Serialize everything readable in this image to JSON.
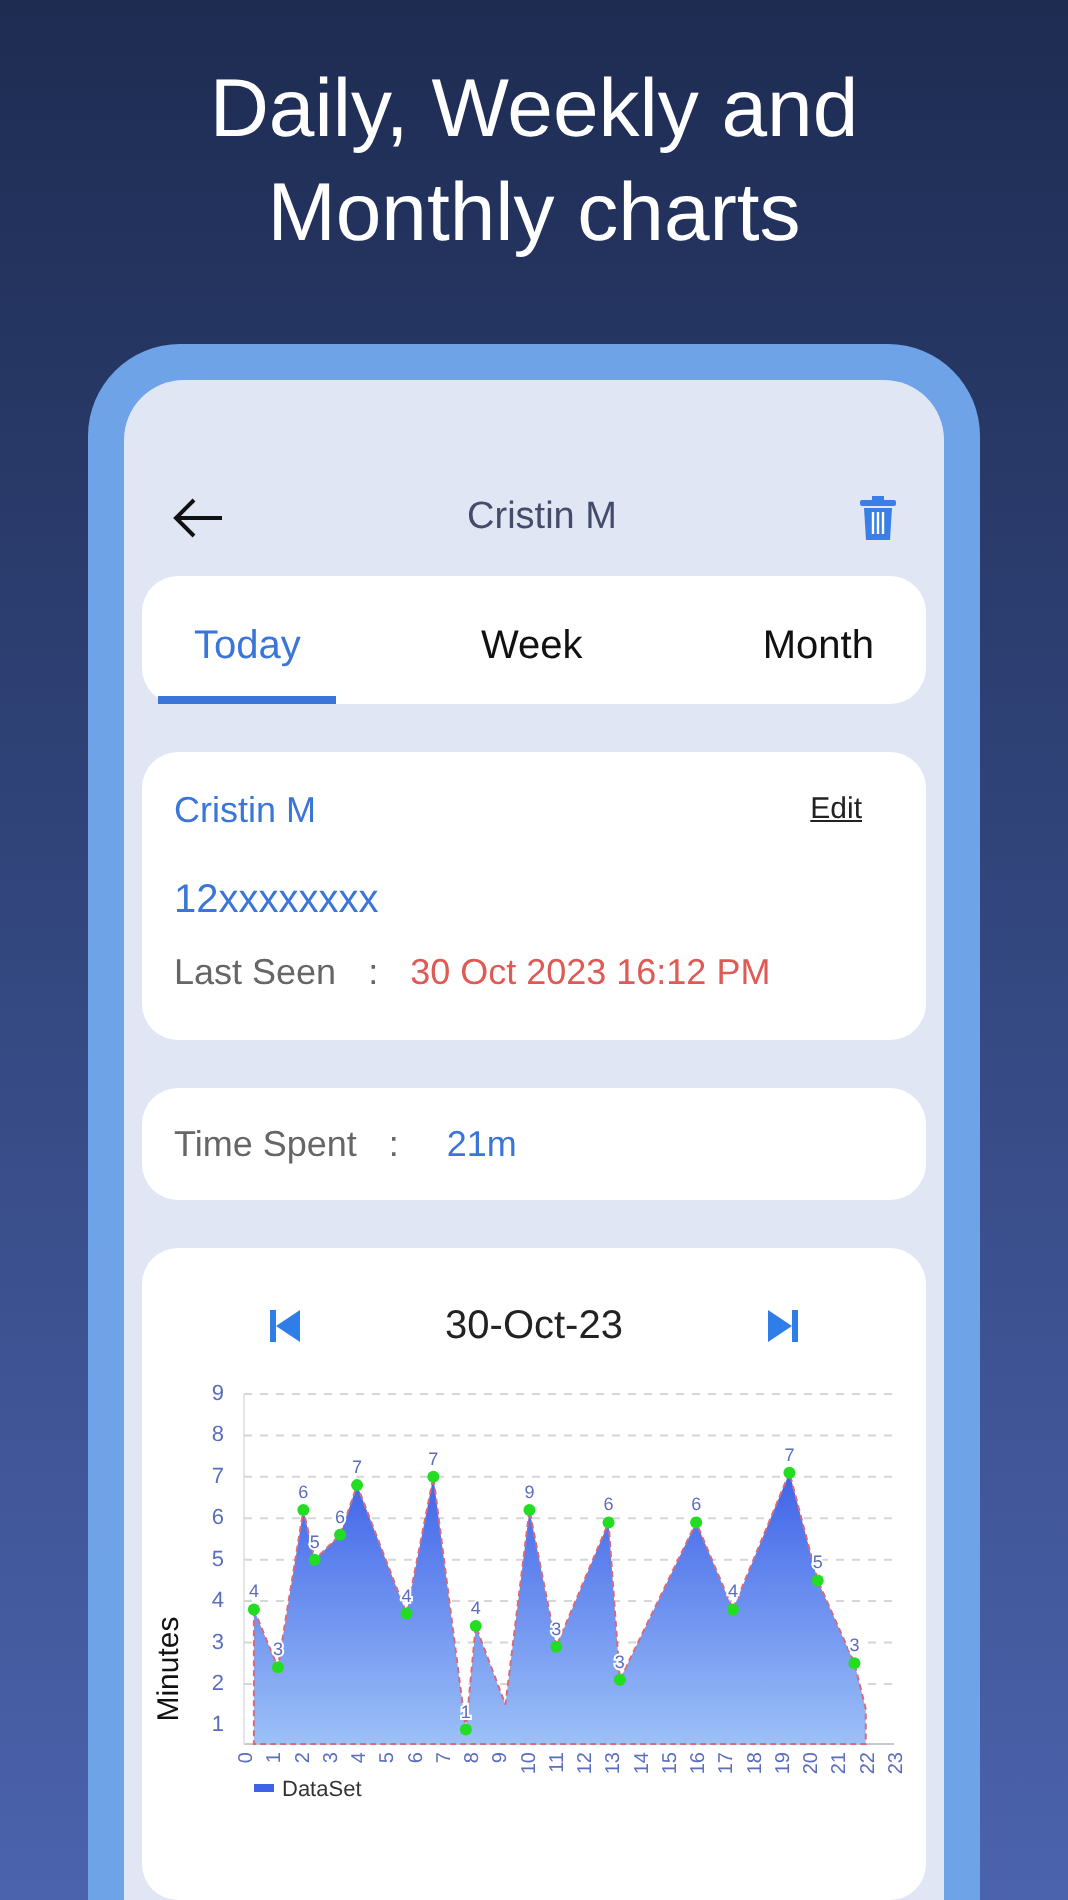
{
  "headline": "Daily, Weekly and Monthly charts",
  "header": {
    "title": "Cristin M"
  },
  "tabs": [
    {
      "label": "Today",
      "selected": true
    },
    {
      "label": "Week",
      "selected": false
    },
    {
      "label": "Month",
      "selected": false
    }
  ],
  "contact": {
    "name": "Cristin M",
    "edit": "Edit",
    "number": "12xxxxxxxx",
    "last_seen_label": "Last Seen",
    "separator": ":",
    "last_seen": "30 Oct 2023 16:12 PM"
  },
  "time_spent": {
    "label": "Time Spent",
    "separator": ":",
    "value": "21m"
  },
  "chart_card": {
    "date": "30-Oct-23",
    "chart_data": {
      "type": "area",
      "grid": true,
      "ylabel": "Minutes",
      "xlim": [
        0,
        23
      ],
      "ylim": [
        0.55,
        9
      ],
      "xticks": [
        0,
        1,
        2,
        3,
        4,
        5,
        6,
        7,
        8,
        9,
        10,
        11,
        12,
        13,
        14,
        15,
        16,
        17,
        18,
        19,
        20,
        21,
        22,
        23
      ],
      "yticks": [
        1,
        2,
        3,
        4,
        5,
        6,
        7,
        8,
        9
      ],
      "x": [
        0.35,
        1.2,
        2.1,
        2.5,
        3.4,
        4.0,
        5.75,
        6.7,
        7.85,
        8.2,
        9.25,
        10.1,
        11.05,
        12.9,
        13.3,
        16.0,
        17.3,
        19.3,
        20.3,
        21.6,
        22.0
      ],
      "series": [
        {
          "name": "DataSet",
          "color": "#3f63e8",
          "values": [
            3.8,
            2.4,
            6.2,
            5.0,
            5.6,
            6.8,
            3.7,
            7.0,
            0.9,
            3.4,
            1.5,
            6.2,
            2.9,
            5.9,
            2.1,
            5.9,
            3.8,
            7.1,
            4.5,
            2.5,
            1.4
          ]
        }
      ],
      "value_labels": [
        "4",
        "3",
        "6",
        "5",
        "6",
        "7",
        "4",
        "7",
        "1",
        "4",
        null,
        "9",
        "3",
        "6",
        "3",
        "6",
        "4",
        "7",
        "5",
        "3",
        null
      ]
    }
  }
}
